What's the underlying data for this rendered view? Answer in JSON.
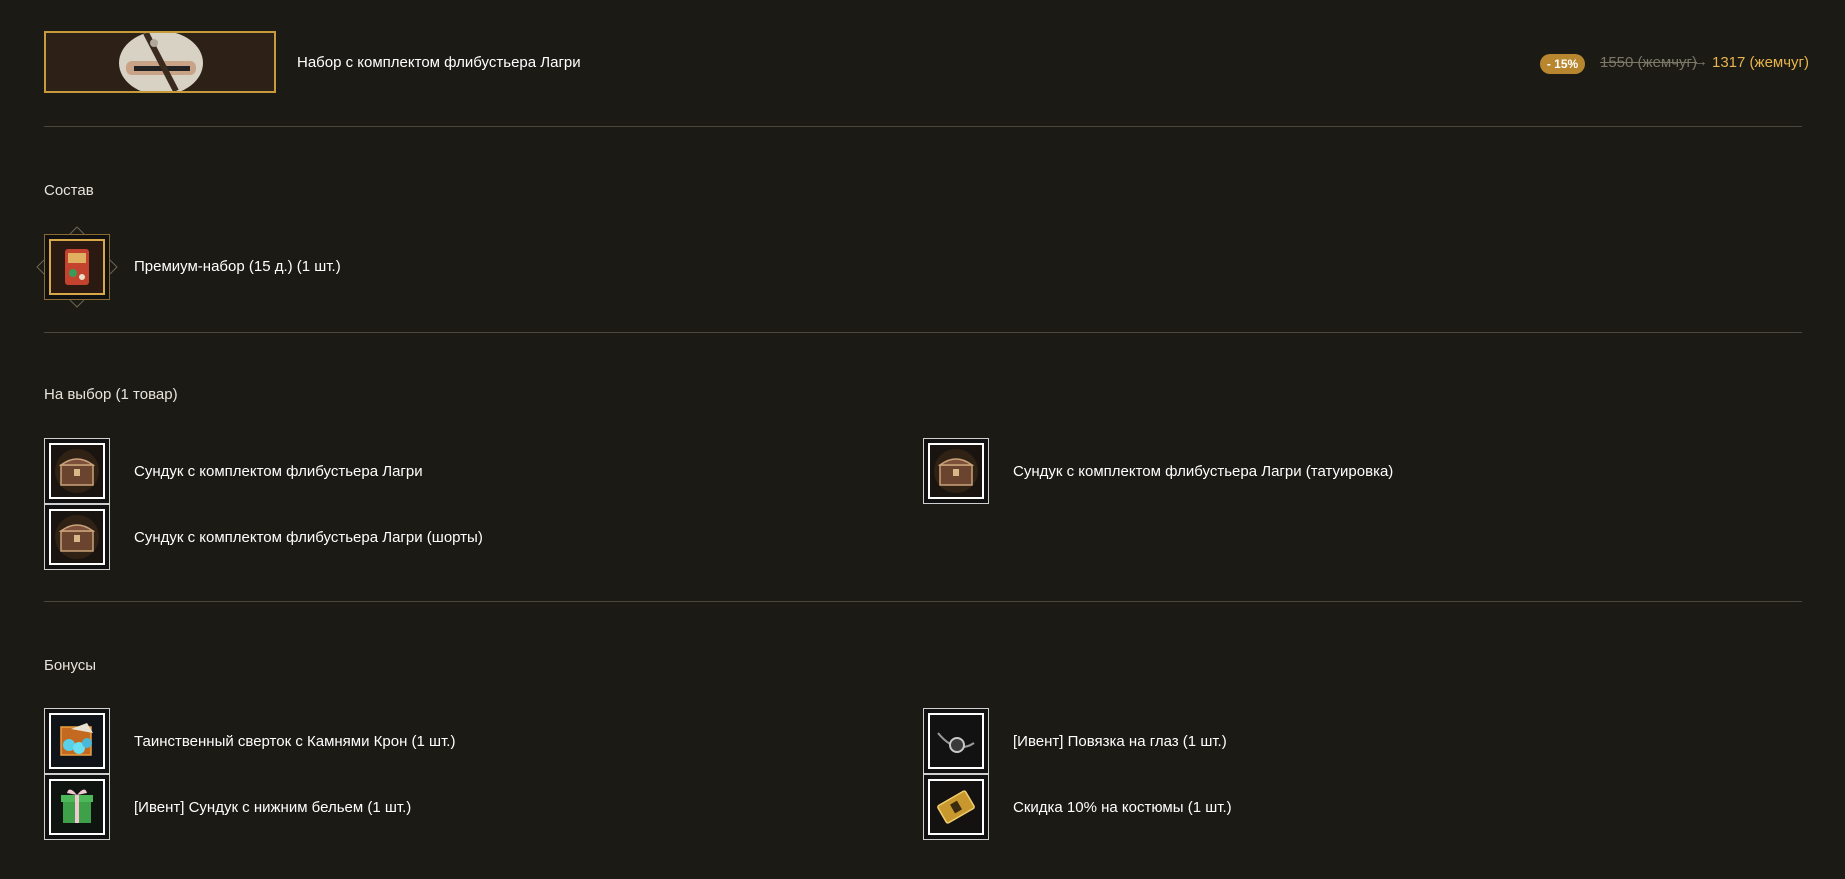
{
  "bundle": {
    "title": "Набор с комплектом флибустьера Лагри",
    "discount_badge": "- 15%",
    "old_price": "1550 (жемчуг)",
    "arrow": "→",
    "new_price": "1317 (жемчуг)"
  },
  "sections": {
    "composition": {
      "title": "Состав",
      "items": [
        {
          "label": "Премиум-набор (15 д.) (1 шт.)",
          "icon": "premium-pack-icon"
        }
      ]
    },
    "choice": {
      "title": "На выбор (1 товар)",
      "items": [
        {
          "label": "Сундук с комплектом флибустьера Лагри",
          "icon": "chest-icon"
        },
        {
          "label": "Сундук с комплектом флибустьера Лагри (татуировка)",
          "icon": "chest-icon"
        },
        {
          "label": "Сундук с комплектом флибустьера Лагри (шорты)",
          "icon": "chest-icon"
        }
      ]
    },
    "bonuses": {
      "title": "Бонусы",
      "items": [
        {
          "label": "Таинственный сверток с Камнями Крон (1 шт.)",
          "icon": "gem-bundle-icon"
        },
        {
          "label": "[Ивент] Повязка на глаз (1 шт.)",
          "icon": "eyepatch-icon"
        },
        {
          "label": "[Ивент] Сундук с нижним бельем (1 шт.)",
          "icon": "gift-box-icon"
        },
        {
          "label": "Скидка 10% на костюмы (1 шт.)",
          "icon": "coupon-icon"
        }
      ]
    }
  },
  "colors": {
    "background": "#1b1a14",
    "accent_gold": "#e8b44c",
    "badge": "#b8862e",
    "divider": "#4a473d"
  }
}
